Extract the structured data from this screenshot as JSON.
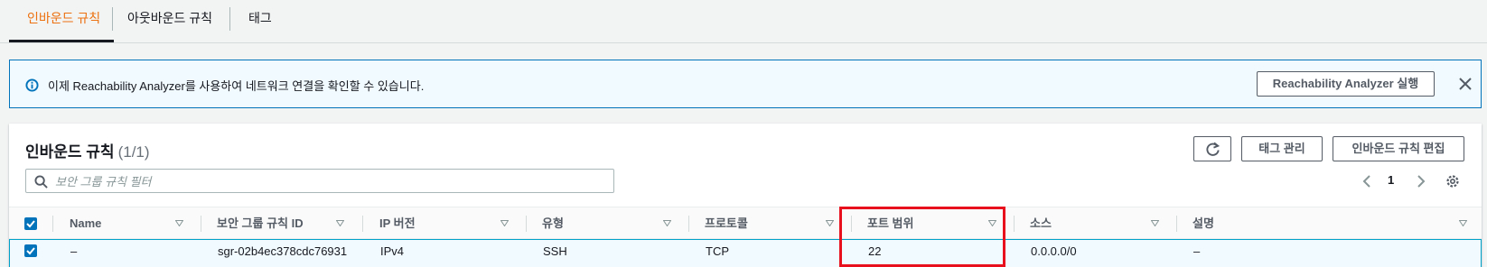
{
  "tabs": [
    {
      "label": "인바운드 규칙",
      "active": true
    },
    {
      "label": "아웃바운드 규칙",
      "active": false
    },
    {
      "label": "태그",
      "active": false
    }
  ],
  "banner": {
    "text": "이제 Reachability Analyzer를 사용하여 네트워크 연결을 확인할 수 있습니다.",
    "button_label": "Reachability Analyzer 실행",
    "info_icon": "info-icon",
    "close_icon": "close-icon"
  },
  "panel": {
    "title": "인바운드 규칙",
    "count": "(1/1)",
    "refresh_icon": "refresh-icon",
    "manage_tags_label": "태그 관리",
    "edit_rules_label": "인바운드 규칙 편집"
  },
  "filter": {
    "placeholder": "보안 그룹 규칙 필터",
    "value": ""
  },
  "pagination": {
    "current_page": "1"
  },
  "table": {
    "columns": [
      "Name",
      "보안 그룹 규칙 ID",
      "IP 버전",
      "유형",
      "프로토콜",
      "포트 범위",
      "소스",
      "설명"
    ],
    "rows": [
      {
        "selected": true,
        "cells": [
          "–",
          "sgr-02b4ec378cdc76931",
          "IPv4",
          "SSH",
          "TCP",
          "22",
          "0.0.0.0/0",
          "–"
        ]
      }
    ]
  },
  "colors": {
    "accent": "#ec7211",
    "primary": "#0073bb",
    "highlight": "#e8101c"
  }
}
